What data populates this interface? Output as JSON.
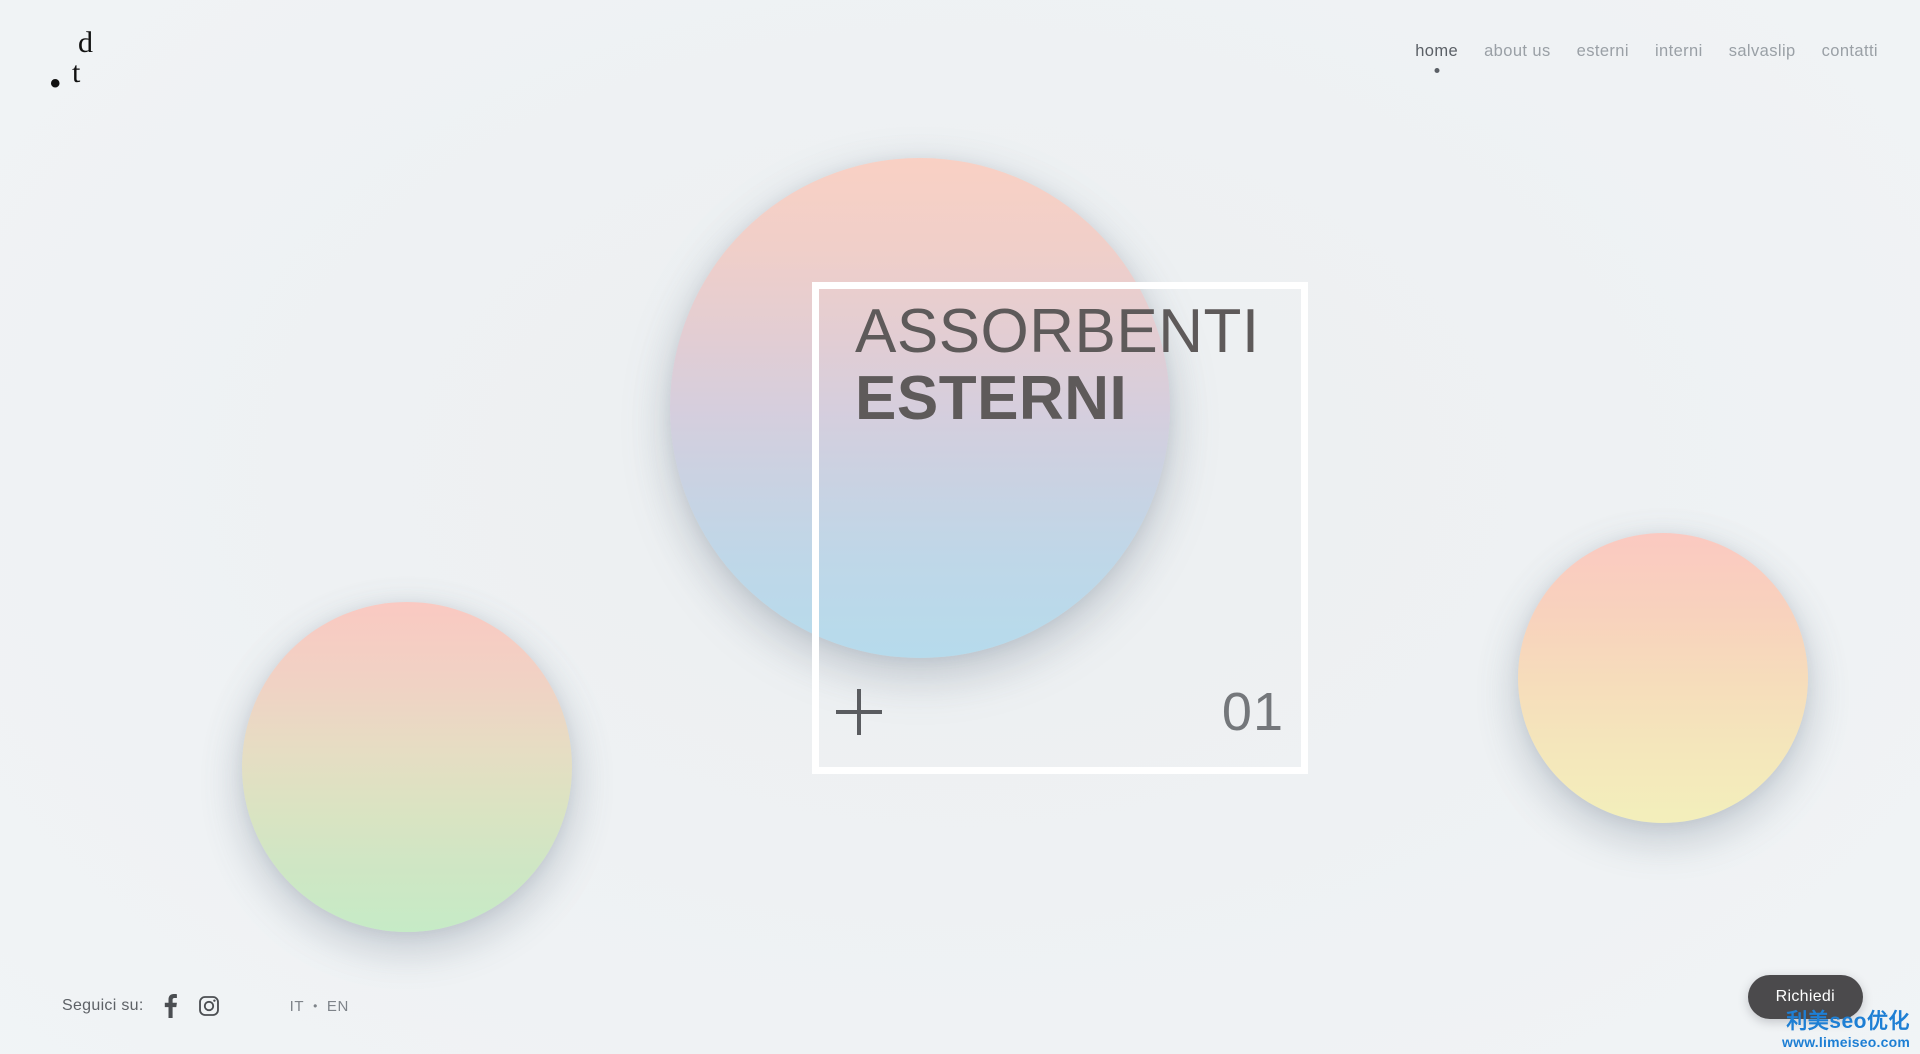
{
  "site": {
    "background_color": "#eef1f3",
    "logo": {
      "top_letter": "d",
      "dot": "•",
      "bottom_letter": "t",
      "alt": "d.t"
    }
  },
  "nav": {
    "items": [
      {
        "label": "home",
        "active": true
      },
      {
        "label": "about us",
        "active": false
      },
      {
        "label": "esterni",
        "active": false
      },
      {
        "label": "interni",
        "active": false
      },
      {
        "label": "salvaslip",
        "active": false
      },
      {
        "label": "contatti",
        "active": false
      }
    ],
    "active_color": "#5b6066",
    "inactive_color": "#9aa0a6"
  },
  "hero": {
    "line1": "ASSORBENTI",
    "line2": "ESTERNI",
    "text_color": "#5e5a5a",
    "slide_number": "01",
    "expand_icon": "plus-icon",
    "frame_color": "#ffffff"
  },
  "decor": {
    "circles": [
      {
        "name": "circle-center",
        "gradient_from": "#f9d0c4",
        "gradient_mid": "#d6cedd",
        "gradient_to": "#b6dbec"
      },
      {
        "name": "circle-left",
        "gradient_from": "#fac9c2",
        "gradient_mid": "#e6ddc3",
        "gradient_to": "#c6ebc6"
      },
      {
        "name": "circle-right",
        "gradient_from": "#fbc9c1",
        "gradient_mid": "#f6ddbb",
        "gradient_to": "#f3efbb"
      }
    ]
  },
  "footer": {
    "follow_label": "Seguici su:",
    "social": [
      {
        "name": "facebook-icon",
        "label": "f"
      },
      {
        "name": "instagram-icon",
        "label": "Instagram"
      }
    ],
    "languages": {
      "it": "IT",
      "separator": "•",
      "en": "EN"
    },
    "cta_label": "Richiedi",
    "cta_color": "#4b4a4c"
  },
  "watermark": {
    "line1": "利美seo优化",
    "line2": "www.limeiseo.com",
    "color": "#1e7fd4"
  }
}
